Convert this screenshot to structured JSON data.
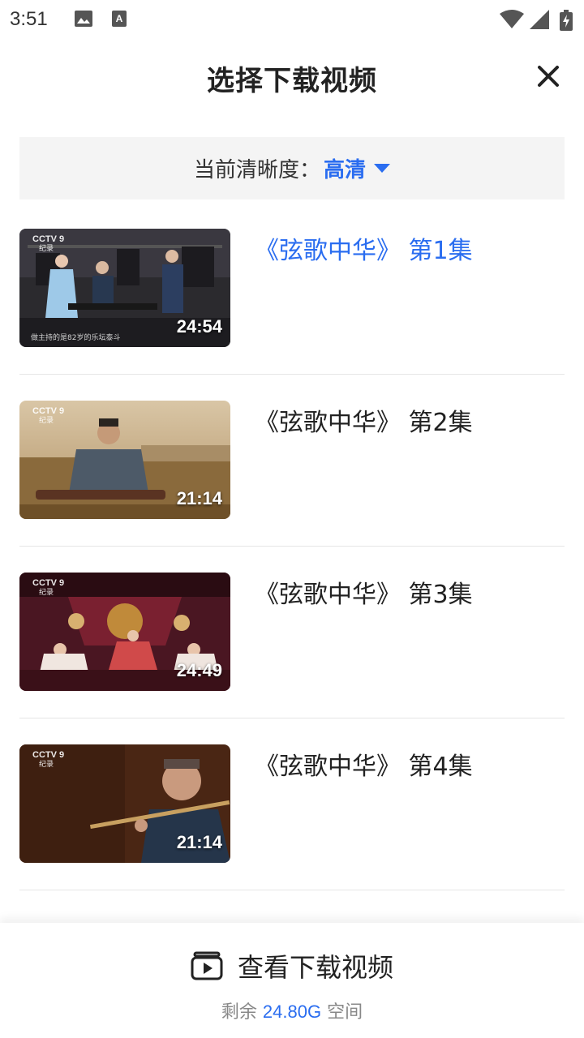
{
  "status_bar": {
    "time": "3:51",
    "icons": [
      "photo-icon",
      "a-keyboard-icon",
      "wifi-icon",
      "signal-icon",
      "battery-charging-icon"
    ]
  },
  "header": {
    "title": "选择下载视频",
    "close_icon": "close-icon"
  },
  "quality": {
    "label": "当前清晰度：",
    "value": "高清",
    "accent_color": "#2a6df0"
  },
  "episodes": [
    {
      "title": "《弦歌中华》 第1集",
      "duration": "24:54",
      "active": true,
      "logo": "CCTV 9",
      "logo_sub": "纪录",
      "caption": "做主持的是82岁的乐坛泰斗"
    },
    {
      "title": "《弦歌中华》 第2集",
      "duration": "21:14",
      "active": false,
      "logo": "CCTV 9",
      "logo_sub": "纪录",
      "caption": ""
    },
    {
      "title": "《弦歌中华》 第3集",
      "duration": "24:49",
      "active": false,
      "logo": "CCTV 9",
      "logo_sub": "纪录",
      "caption": ""
    },
    {
      "title": "《弦歌中华》 第4集",
      "duration": "21:14",
      "active": false,
      "logo": "CCTV 9",
      "logo_sub": "纪录",
      "caption": ""
    }
  ],
  "bottom": {
    "view_label": "查看下载视频",
    "storage_prefix": "剩余 ",
    "storage_amount": "24.80G",
    "storage_suffix": " 空间"
  }
}
